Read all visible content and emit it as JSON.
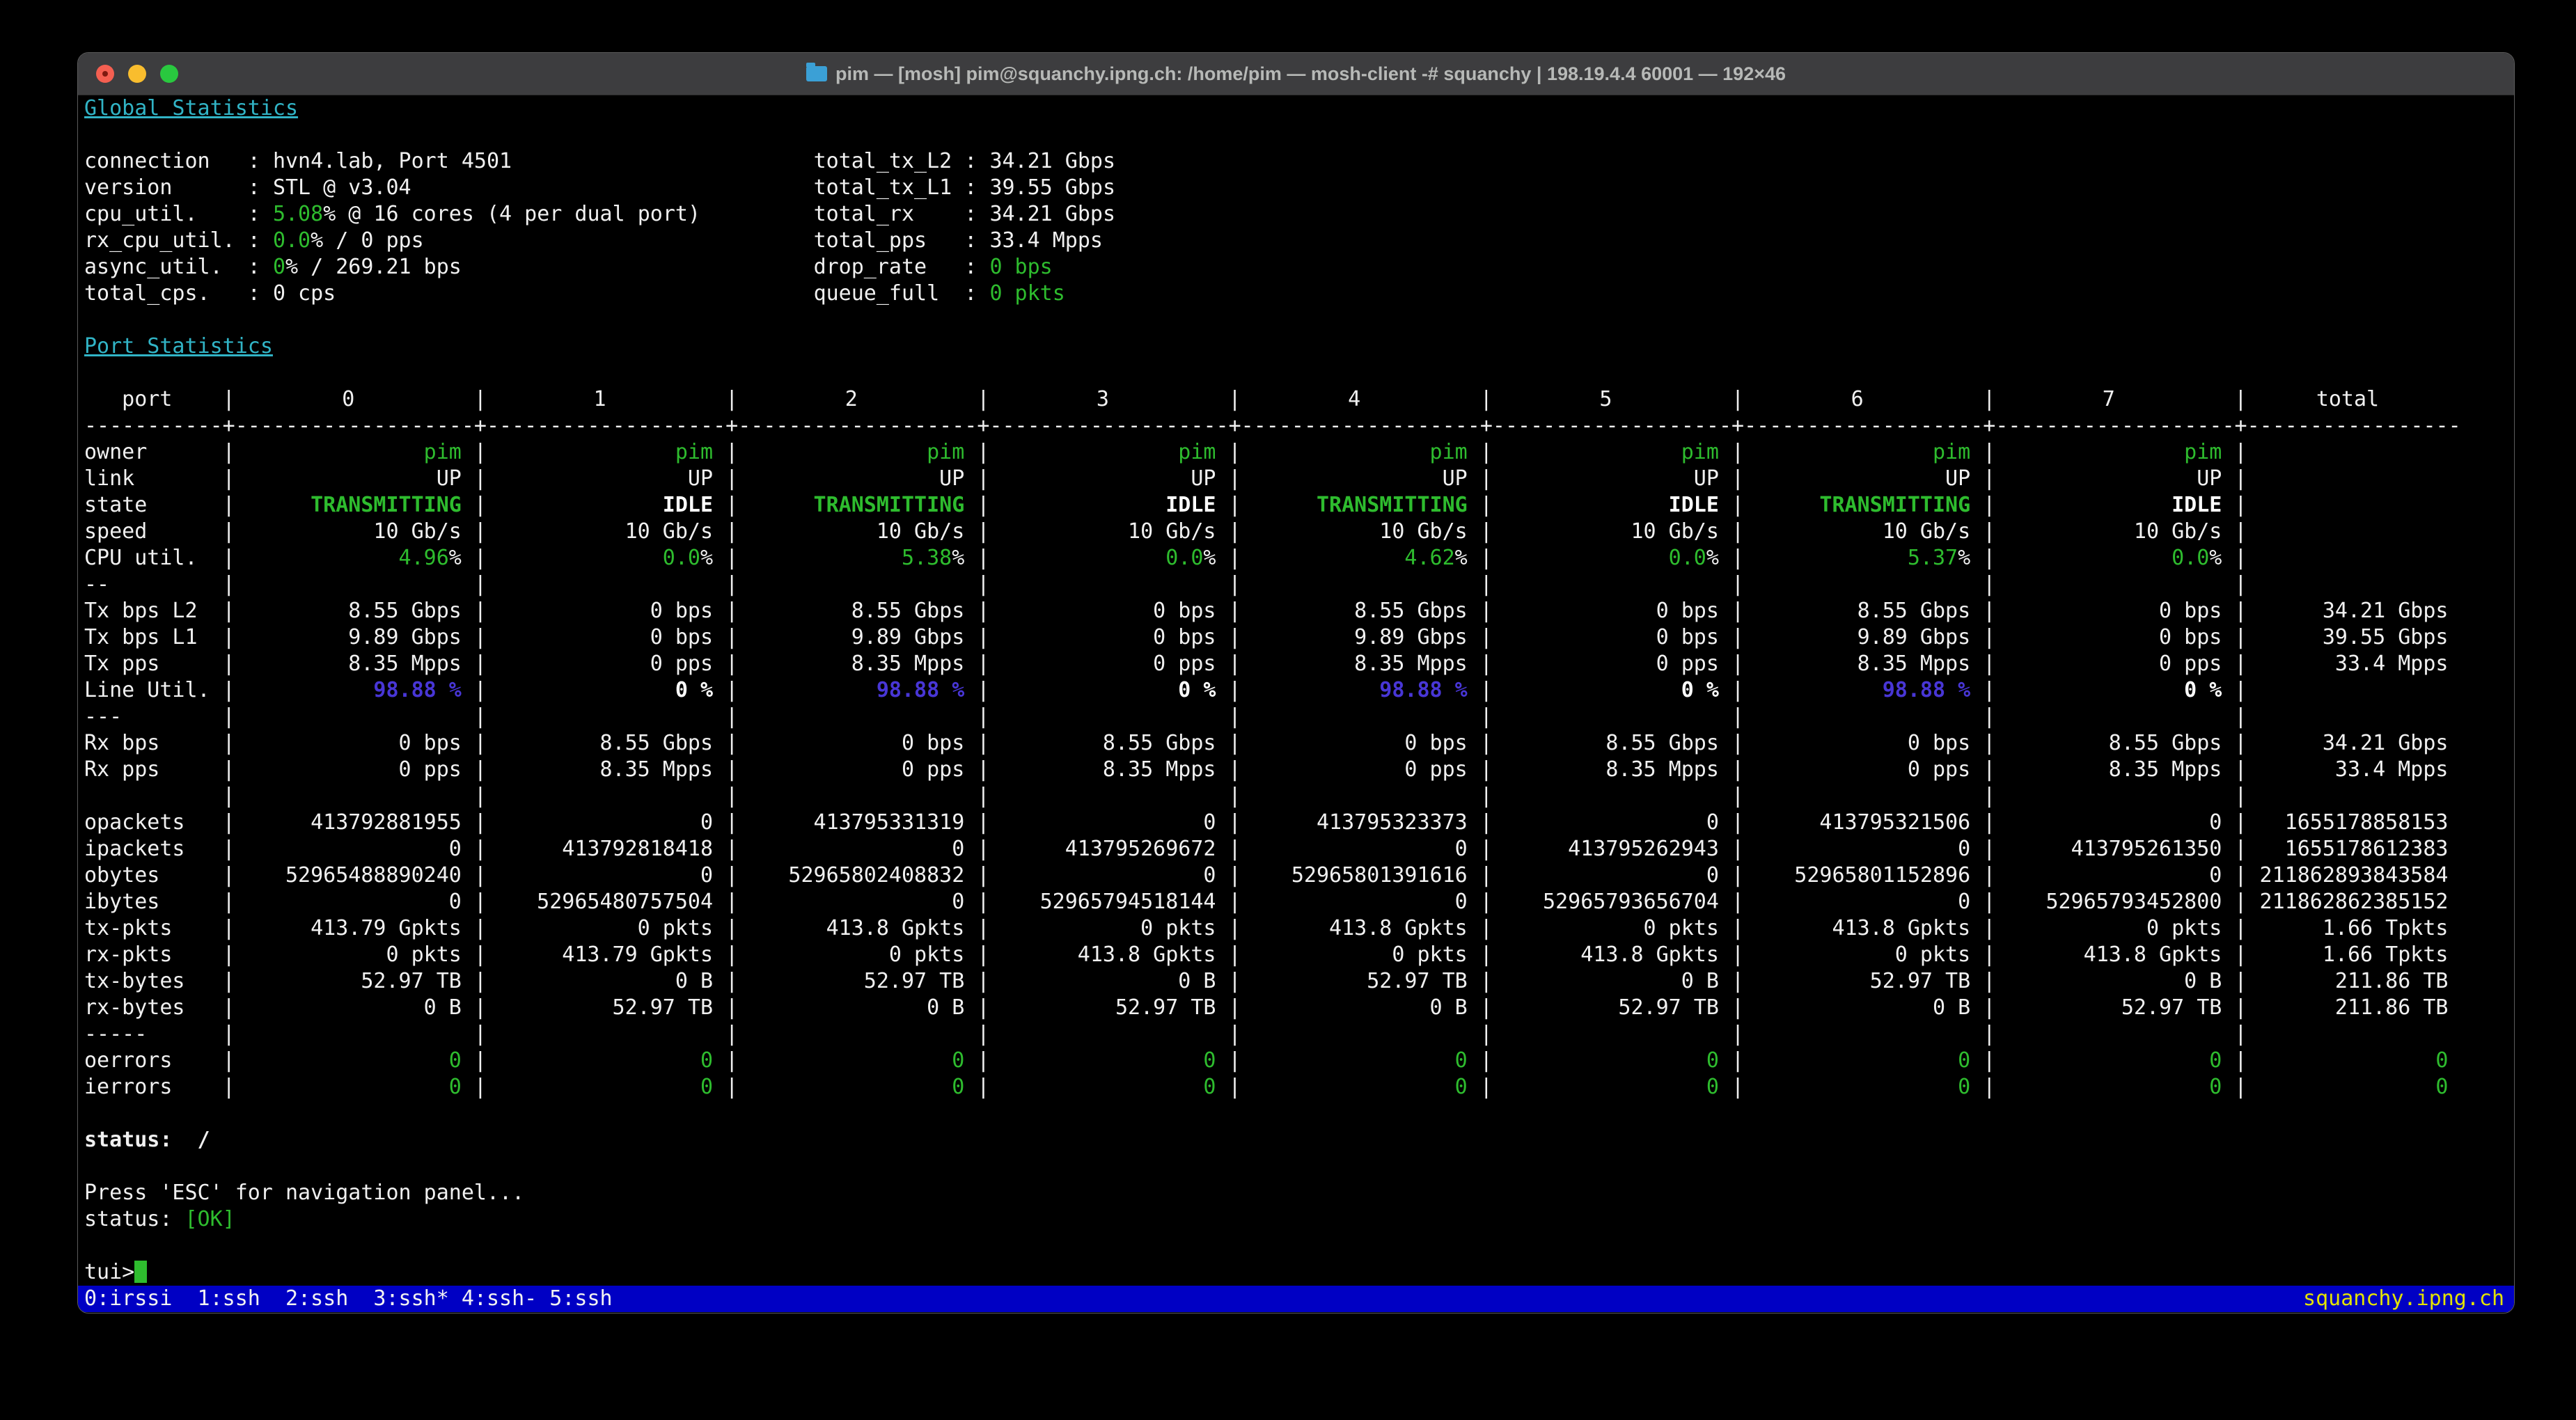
{
  "window": {
    "title": "pim — [mosh] pim@squanchy.ipng.ch: /home/pim — mosh-client -# squanchy | 198.19.4.4 60001 — 192×46"
  },
  "colors": {
    "green": "#2ebc2e",
    "cyan": "#31b4c6",
    "blue": "#4836d6",
    "yellow": "#e3e300",
    "statusbar_bg": "#0000c4"
  },
  "global_stats": {
    "heading": "Global Statistics",
    "left": [
      {
        "label": "connection",
        "value_segments": [
          [
            "hvn4.lab, Port 4501",
            ""
          ]
        ]
      },
      {
        "label": "version",
        "value_segments": [
          [
            "STL @ v3.04",
            ""
          ]
        ]
      },
      {
        "label": "cpu_util.",
        "value_segments": [
          [
            "5.08",
            "g"
          ],
          [
            "% @ 16 cores (4 per dual port)",
            ""
          ]
        ]
      },
      {
        "label": "rx_cpu_util.",
        "value_segments": [
          [
            "0.0",
            "g"
          ],
          [
            "% / 0 pps",
            ""
          ]
        ]
      },
      {
        "label": "async_util.",
        "value_segments": [
          [
            "0",
            "g"
          ],
          [
            "% / 269.21 bps",
            ""
          ]
        ]
      },
      {
        "label": "total_cps.",
        "value_segments": [
          [
            "0 cps",
            ""
          ]
        ]
      }
    ],
    "right": [
      {
        "label": "total_tx_L2",
        "value_segments": [
          [
            "34.21 Gbps",
            ""
          ]
        ]
      },
      {
        "label": "total_tx_L1",
        "value_segments": [
          [
            "39.55 Gbps",
            ""
          ]
        ]
      },
      {
        "label": "total_rx",
        "value_segments": [
          [
            "34.21 Gbps",
            ""
          ]
        ]
      },
      {
        "label": "total_pps",
        "value_segments": [
          [
            "33.4 Mpps",
            ""
          ]
        ]
      },
      {
        "label": "drop_rate",
        "value_segments": [
          [
            "0 bps",
            "g"
          ]
        ]
      },
      {
        "label": "queue_full",
        "value_segments": [
          [
            "0 pkts",
            "g"
          ]
        ]
      }
    ]
  },
  "port_stats": {
    "heading": "Port Statistics",
    "columns": [
      "port",
      "0",
      "1",
      "2",
      "3",
      "4",
      "5",
      "6",
      "7",
      "total"
    ],
    "rows": [
      {
        "type": "data",
        "label": "owner",
        "cells": [
          [
            [
              "pim",
              "g"
            ]
          ],
          [
            [
              "pim",
              "g"
            ]
          ],
          [
            [
              "pim",
              "g"
            ]
          ],
          [
            [
              "pim",
              "g"
            ]
          ],
          [
            [
              "pim",
              "g"
            ]
          ],
          [
            [
              "pim",
              "g"
            ]
          ],
          [
            [
              "pim",
              "g"
            ]
          ],
          [
            [
              "pim",
              "g"
            ]
          ]
        ],
        "total": ""
      },
      {
        "type": "data",
        "label": "link",
        "cells": [
          "UP",
          "UP",
          "UP",
          "UP",
          "UP",
          "UP",
          "UP",
          "UP"
        ],
        "total": ""
      },
      {
        "type": "data",
        "label": "state",
        "cells": [
          [
            [
              "TRANSMITTING",
              "gb"
            ]
          ],
          [
            [
              "IDLE",
              "wb"
            ]
          ],
          [
            [
              "TRANSMITTING",
              "gb"
            ]
          ],
          [
            [
              "IDLE",
              "wb"
            ]
          ],
          [
            [
              "TRANSMITTING",
              "gb"
            ]
          ],
          [
            [
              "IDLE",
              "wb"
            ]
          ],
          [
            [
              "TRANSMITTING",
              "gb"
            ]
          ],
          [
            [
              "IDLE",
              "wb"
            ]
          ]
        ],
        "total": ""
      },
      {
        "type": "data",
        "label": "speed",
        "cells": [
          "10 Gb/s",
          "10 Gb/s",
          "10 Gb/s",
          "10 Gb/s",
          "10 Gb/s",
          "10 Gb/s",
          "10 Gb/s",
          "10 Gb/s"
        ],
        "total": ""
      },
      {
        "type": "data",
        "label": "CPU util.",
        "cells": [
          [
            [
              "4.96",
              "g"
            ],
            [
              "%",
              ""
            ]
          ],
          [
            [
              "0.0",
              "g"
            ],
            [
              "%",
              ""
            ]
          ],
          [
            [
              "5.38",
              "g"
            ],
            [
              "%",
              ""
            ]
          ],
          [
            [
              "0.0",
              "g"
            ],
            [
              "%",
              ""
            ]
          ],
          [
            [
              "4.62",
              "g"
            ],
            [
              "%",
              ""
            ]
          ],
          [
            [
              "0.0",
              "g"
            ],
            [
              "%",
              ""
            ]
          ],
          [
            [
              "5.37",
              "g"
            ],
            [
              "%",
              ""
            ]
          ],
          [
            [
              "0.0",
              "g"
            ],
            [
              "%",
              ""
            ]
          ]
        ],
        "total": ""
      },
      {
        "type": "sep",
        "label": "--"
      },
      {
        "type": "data",
        "label": "Tx bps L2",
        "cells": [
          "8.55 Gbps",
          "0 bps",
          "8.55 Gbps",
          "0 bps",
          "8.55 Gbps",
          "0 bps",
          "8.55 Gbps",
          "0 bps"
        ],
        "total": "34.21 Gbps"
      },
      {
        "type": "data",
        "label": "Tx bps L1",
        "cells": [
          "9.89 Gbps",
          "0 bps",
          "9.89 Gbps",
          "0 bps",
          "9.89 Gbps",
          "0 bps",
          "9.89 Gbps",
          "0 bps"
        ],
        "total": "39.55 Gbps"
      },
      {
        "type": "data",
        "label": "Tx pps",
        "cells": [
          "8.35 Mpps",
          "0 pps",
          "8.35 Mpps",
          "0 pps",
          "8.35 Mpps",
          "0 pps",
          "8.35 Mpps",
          "0 pps"
        ],
        "total": "33.4 Mpps"
      },
      {
        "type": "data",
        "label": "Line Util.",
        "cells": [
          [
            [
              "98.88 %",
              "bb"
            ]
          ],
          [
            [
              "0 %",
              "wb"
            ]
          ],
          [
            [
              "98.88 %",
              "bb"
            ]
          ],
          [
            [
              "0 %",
              "wb"
            ]
          ],
          [
            [
              "98.88 %",
              "bb"
            ]
          ],
          [
            [
              "0 %",
              "wb"
            ]
          ],
          [
            [
              "98.88 %",
              "bb"
            ]
          ],
          [
            [
              "0 %",
              "wb"
            ]
          ]
        ],
        "total": ""
      },
      {
        "type": "sep",
        "label": "---"
      },
      {
        "type": "data",
        "label": "Rx bps",
        "cells": [
          "0 bps",
          "8.55 Gbps",
          "0 bps",
          "8.55 Gbps",
          "0 bps",
          "8.55 Gbps",
          "0 bps",
          "8.55 Gbps"
        ],
        "total": "34.21 Gbps"
      },
      {
        "type": "data",
        "label": "Rx pps",
        "cells": [
          "0 pps",
          "8.35 Mpps",
          "0 pps",
          "8.35 Mpps",
          "0 pps",
          "8.35 Mpps",
          "0 pps",
          "8.35 Mpps"
        ],
        "total": "33.4 Mpps"
      },
      {
        "type": "sep",
        "label": ""
      },
      {
        "type": "data",
        "label": "opackets",
        "cells": [
          "413792881955",
          "0",
          "413795331319",
          "0",
          "413795323373",
          "0",
          "413795321506",
          "0"
        ],
        "total": "1655178858153"
      },
      {
        "type": "data",
        "label": "ipackets",
        "cells": [
          "0",
          "413792818418",
          "0",
          "413795269672",
          "0",
          "413795262943",
          "0",
          "413795261350"
        ],
        "total": "1655178612383"
      },
      {
        "type": "data",
        "label": "obytes",
        "cells": [
          "52965488890240",
          "0",
          "52965802408832",
          "0",
          "52965801391616",
          "0",
          "52965801152896",
          "0"
        ],
        "total": "211862893843584"
      },
      {
        "type": "data",
        "label": "ibytes",
        "cells": [
          "0",
          "52965480757504",
          "0",
          "52965794518144",
          "0",
          "52965793656704",
          "0",
          "52965793452800"
        ],
        "total": "211862862385152"
      },
      {
        "type": "data",
        "label": "tx-pkts",
        "cells": [
          "413.79 Gpkts",
          "0 pkts",
          "413.8 Gpkts",
          "0 pkts",
          "413.8 Gpkts",
          "0 pkts",
          "413.8 Gpkts",
          "0 pkts"
        ],
        "total": "1.66 Tpkts"
      },
      {
        "type": "data",
        "label": "rx-pkts",
        "cells": [
          "0 pkts",
          "413.79 Gpkts",
          "0 pkts",
          "413.8 Gpkts",
          "0 pkts",
          "413.8 Gpkts",
          "0 pkts",
          "413.8 Gpkts"
        ],
        "total": "1.66 Tpkts"
      },
      {
        "type": "data",
        "label": "tx-bytes",
        "cells": [
          "52.97 TB",
          "0 B",
          "52.97 TB",
          "0 B",
          "52.97 TB",
          "0 B",
          "52.97 TB",
          "0 B"
        ],
        "total": "211.86 TB"
      },
      {
        "type": "data",
        "label": "rx-bytes",
        "cells": [
          "0 B",
          "52.97 TB",
          "0 B",
          "52.97 TB",
          "0 B",
          "52.97 TB",
          "0 B",
          "52.97 TB"
        ],
        "total": "211.86 TB"
      },
      {
        "type": "sep",
        "label": "-----"
      },
      {
        "type": "data",
        "label": "oerrors",
        "cells": [
          [
            [
              "0",
              "g"
            ]
          ],
          [
            [
              "0",
              "g"
            ]
          ],
          [
            [
              "0",
              "g"
            ]
          ],
          [
            [
              "0",
              "g"
            ]
          ],
          [
            [
              "0",
              "g"
            ]
          ],
          [
            [
              "0",
              "g"
            ]
          ],
          [
            [
              "0",
              "g"
            ]
          ],
          [
            [
              "0",
              "g"
            ]
          ]
        ],
        "total": [
          [
            "0",
            "g"
          ]
        ]
      },
      {
        "type": "data",
        "label": "ierrors",
        "cells": [
          [
            [
              "0",
              "g"
            ]
          ],
          [
            [
              "0",
              "g"
            ]
          ],
          [
            [
              "0",
              "g"
            ]
          ],
          [
            [
              "0",
              "g"
            ]
          ],
          [
            [
              "0",
              "g"
            ]
          ],
          [
            [
              "0",
              "g"
            ]
          ],
          [
            [
              "0",
              "g"
            ]
          ],
          [
            [
              "0",
              "g"
            ]
          ]
        ],
        "total": [
          [
            "0",
            "g"
          ]
        ]
      }
    ]
  },
  "status_spinner": {
    "label": "status:",
    "value": "/"
  },
  "nav_hint": "Press 'ESC' for navigation panel...",
  "status_ok": {
    "label": "status:",
    "value": "[OK]"
  },
  "prompt": {
    "text": "tui>"
  },
  "screen_bar": {
    "windows": "0:irssi  1:ssh  2:ssh  3:ssh* 4:ssh- 5:ssh",
    "hostname": "squanchy.ipng.ch"
  }
}
